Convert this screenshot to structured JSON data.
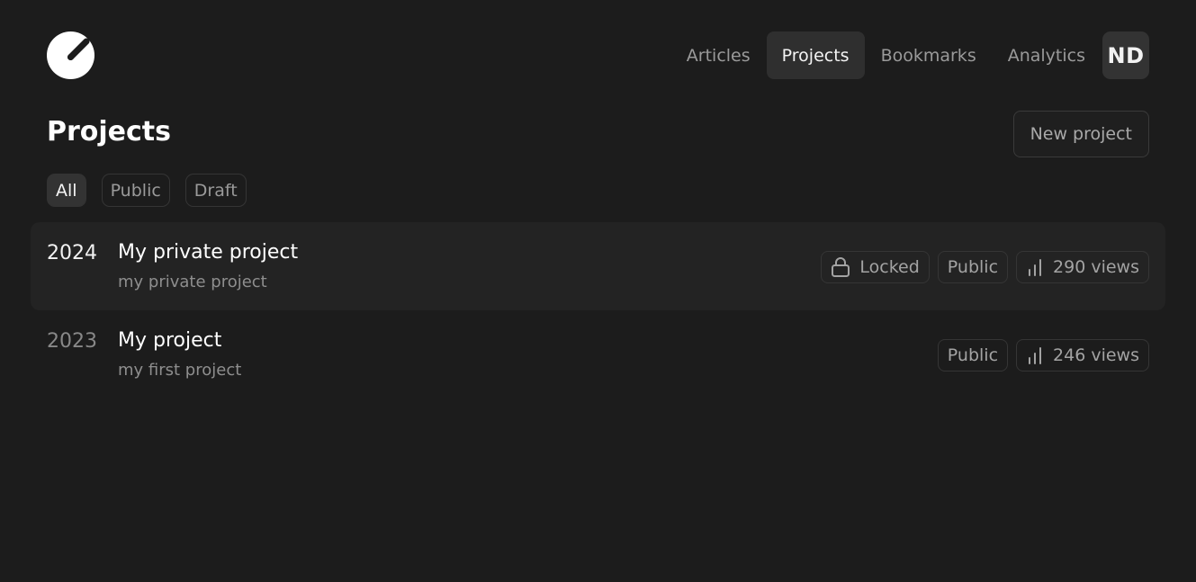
{
  "header": {
    "logo_icon": "app-logo-icon",
    "nav": [
      {
        "label": "Articles",
        "active": false
      },
      {
        "label": "Projects",
        "active": true
      },
      {
        "label": "Bookmarks",
        "active": false
      },
      {
        "label": "Analytics",
        "active": false
      }
    ],
    "avatar_initials": "ND"
  },
  "main": {
    "title": "Projects",
    "new_project_label": "New project",
    "filters": [
      {
        "label": "All",
        "active": true
      },
      {
        "label": "Public",
        "active": false
      },
      {
        "label": "Draft",
        "active": false
      }
    ],
    "projects": [
      {
        "year": "2024",
        "title": "My private project",
        "description": "my private project",
        "locked_label": "Locked",
        "visibility": "Public",
        "views": "290 views"
      },
      {
        "year": "2023",
        "title": "My project",
        "description": "my first project",
        "visibility": "Public",
        "views": "246 views"
      }
    ]
  },
  "colors": {
    "background": "#1c1c1c",
    "active_bg": "#2f2f2f",
    "text_muted": "#9a9a9a"
  }
}
